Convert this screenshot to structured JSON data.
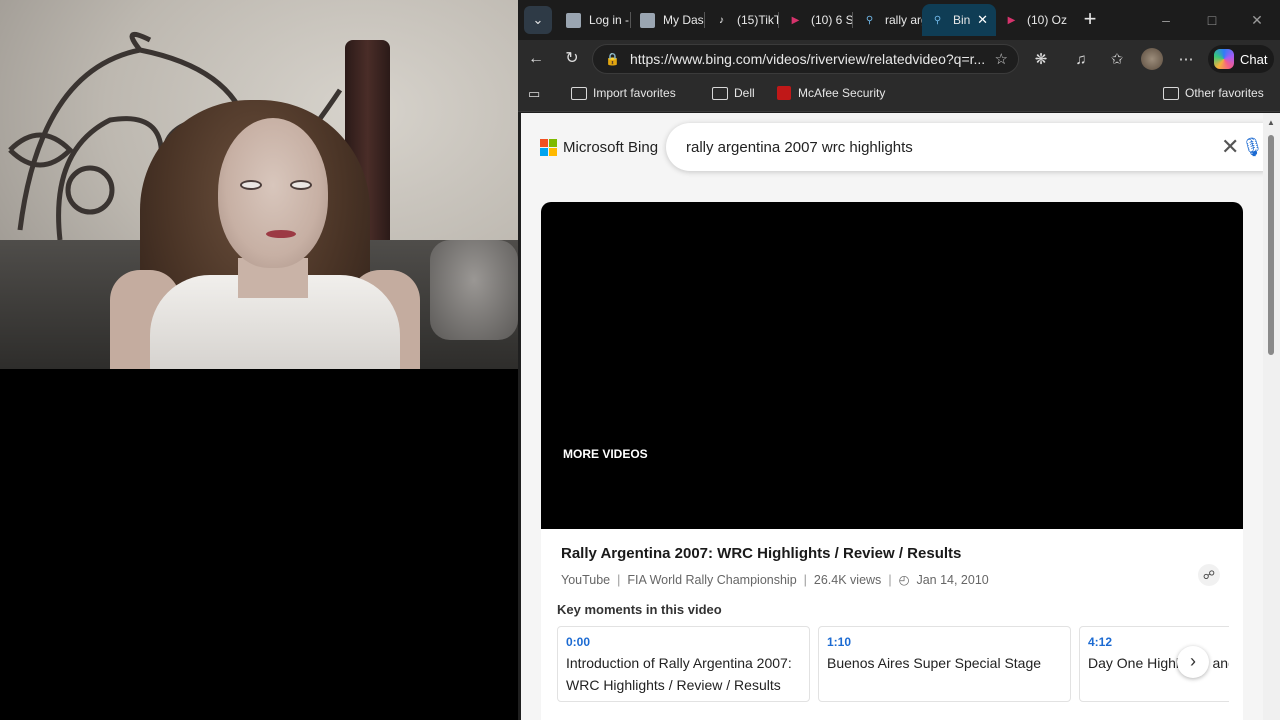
{
  "tabs": [
    {
      "label": "Log in -",
      "icon": "document-icon"
    },
    {
      "label": "My Das",
      "icon": "document-icon"
    },
    {
      "label": "(15)TikT",
      "icon": "tiktok-icon"
    },
    {
      "label": "(10) 6 S",
      "icon": "youtube-icon"
    },
    {
      "label": "rally arg",
      "icon": "bing-search-icon"
    },
    {
      "label": "Bin",
      "icon": "bing-search-icon",
      "active": true
    },
    {
      "label": "(10) Oz",
      "icon": "youtube-icon"
    }
  ],
  "address": {
    "url": "https://www.bing.com/videos/riverview/relatedvideo?q=r..."
  },
  "toolbar": {
    "chat_label": "Chat"
  },
  "favorites": {
    "items": [
      "Import favorites",
      "Dell",
      "McAfee Security"
    ],
    "other": "Other favorites"
  },
  "bing": {
    "logo_text": "Microsoft Bing",
    "query": "rally argentina 2007 wrc highlights"
  },
  "video": {
    "more_videos": "MORE VIDEOS",
    "title": "Rally Argentina 2007: WRC Highlights / Review / Results",
    "source": "YouTube",
    "channel": "FIA World Rally Championship",
    "views": "26.4K views",
    "date": "Jan 14, 2010",
    "key_moments_heading": "Key moments in this video",
    "moments": [
      {
        "time": "0:00",
        "desc": "Introduction of Rally Argentina 2007: WRC Highlights / Review / Results"
      },
      {
        "time": "1:10",
        "desc": "Buenos Aires Super Special Stage"
      },
      {
        "time": "4:12",
        "desc": "Day One Highlights and"
      }
    ]
  },
  "colors": {
    "accent": "#1b6ad2",
    "active_tab": "#0f3d55",
    "browser_bg": "#2b2b2b"
  }
}
